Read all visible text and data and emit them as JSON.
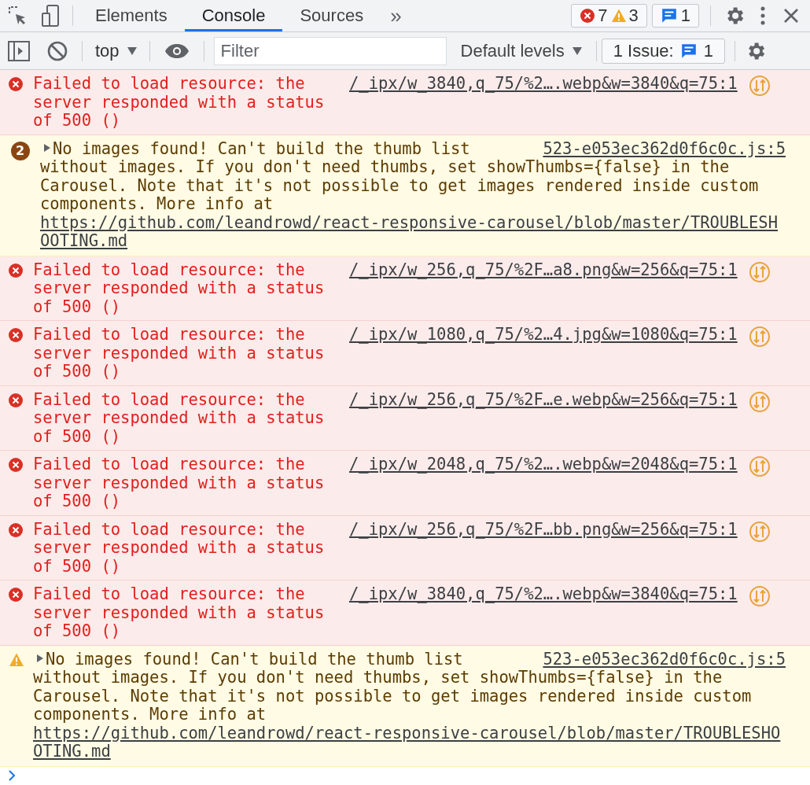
{
  "toolbar": {
    "tabs": [
      {
        "label": "Elements",
        "selected": false
      },
      {
        "label": "Console",
        "selected": true
      },
      {
        "label": "Sources",
        "selected": false
      }
    ],
    "more": "»",
    "error_count": "7",
    "warning_count": "3",
    "info_count": "1"
  },
  "filter_bar": {
    "context": "top",
    "filter": {
      "placeholder": "Filter"
    },
    "levels": "Default levels",
    "issues": {
      "label": "1 Issue:",
      "count": "1"
    }
  },
  "messages": [
    {
      "kind": "error",
      "text": "Failed to load resource: the server responded with a status of 500 ()",
      "source": "/_ipx/w_3840,q_75/%2….webp&w=3840&q=75:1"
    },
    {
      "kind": "warning",
      "count": "2",
      "summary": "No images found! Can't build the thumb list",
      "text": "without images. If you don't need thumbs, set showThumbs={false} in the Carousel. Note that it's not possible to get images rendered inside custom components. More info at ",
      "link": "https://github.com/leandrowd/react-responsive-carousel/blob/master/TROUBLESHOOTING.md",
      "source": "523-e053ec362d0f6c0c.js:5"
    },
    {
      "kind": "error",
      "text": "Failed to load resource: the server responded with a status of 500 ()",
      "source": "/_ipx/w_256,q_75/%2F…a8.png&w=256&q=75:1"
    },
    {
      "kind": "error",
      "text": "Failed to load resource: the server responded with a status of 500 ()",
      "source": "/_ipx/w_1080,q_75/%2…4.jpg&w=1080&q=75:1"
    },
    {
      "kind": "error",
      "text": "Failed to load resource: the server responded with a status of 500 ()",
      "source": "/_ipx/w_256,q_75/%2F…e.webp&w=256&q=75:1"
    },
    {
      "kind": "error",
      "text": "Failed to load resource: the server responded with a status of 500 ()",
      "source": "/_ipx/w_2048,q_75/%2….webp&w=2048&q=75:1"
    },
    {
      "kind": "error",
      "text": "Failed to load resource: the server responded with a status of 500 ()",
      "source": "/_ipx/w_256,q_75/%2F…bb.png&w=256&q=75:1"
    },
    {
      "kind": "error",
      "text": "Failed to load resource: the server responded with a status of 500 ()",
      "source": "/_ipx/w_3840,q_75/%2….webp&w=3840&q=75:1"
    },
    {
      "kind": "warning",
      "summary": "No images found! Can't build the thumb list",
      "text": "without images. If you don't need thumbs, set showThumbs={false} in the Carousel. Note that it's not possible to get images rendered inside custom components. More info at ",
      "link": "https://github.com/leandrowd/react-responsive-carousel/blob/master/TROUBLESHOOTING.md",
      "source": "523-e053ec362d0f6c0c.js:5"
    }
  ]
}
